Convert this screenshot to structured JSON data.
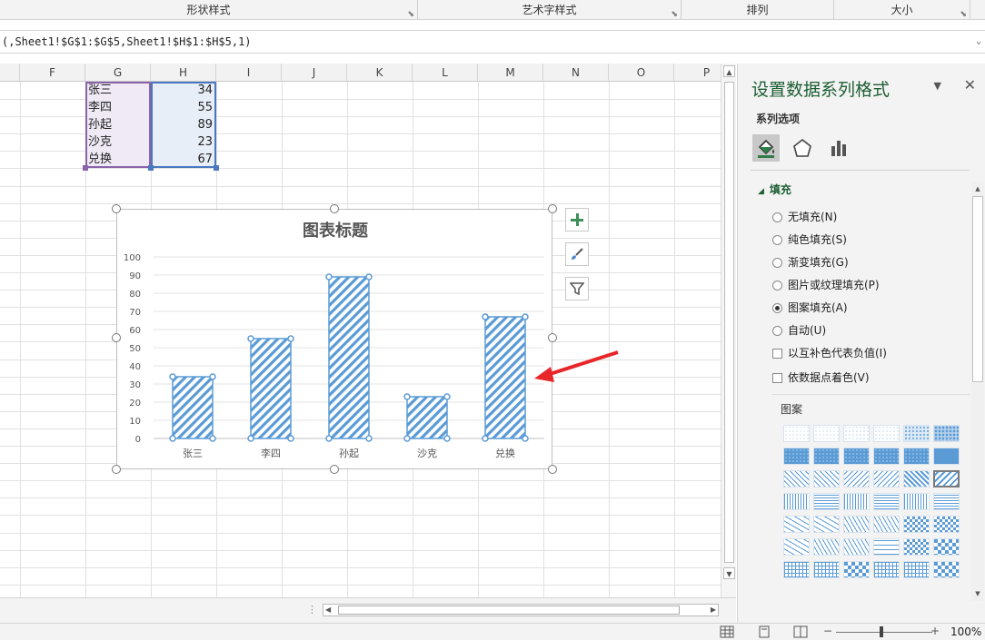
{
  "ribbon": {
    "groups": [
      {
        "label": "形状样式",
        "launcher": "⬊"
      },
      {
        "label": "艺术字样式",
        "launcher": "⬊"
      },
      {
        "label": "排列",
        "launcher": ""
      },
      {
        "label": "大小",
        "launcher": "⬊"
      }
    ]
  },
  "formula_bar": {
    "text": "(,Sheet1!$G$1:$G$5,Sheet1!$H$1:$H$5,1)"
  },
  "sheet": {
    "columns": [
      "F",
      "G",
      "H",
      "I",
      "J",
      "K",
      "L",
      "M",
      "N",
      "O",
      "P"
    ],
    "rows": [
      {
        "name": "张三",
        "value": "34"
      },
      {
        "name": "李四",
        "value": "55"
      },
      {
        "name": "孙起",
        "value": "89"
      },
      {
        "name": "沙克",
        "value": "23"
      },
      {
        "name": "兑换",
        "value": "67"
      }
    ]
  },
  "chart_data": {
    "type": "bar",
    "title": "图表标题",
    "categories": [
      "张三",
      "李四",
      "孙起",
      "沙克",
      "兑换"
    ],
    "values": [
      34,
      55,
      89,
      23,
      67
    ],
    "ylim": [
      0,
      100
    ],
    "yticks": [
      "0",
      "10",
      "20",
      "30",
      "40",
      "50",
      "60",
      "70",
      "80",
      "90",
      "100"
    ],
    "grid": true,
    "fill_pattern": "diagonal-stripes",
    "colors": {
      "bar": "#5b9bd5",
      "bar_bg": "#ffffff"
    }
  },
  "chart_tools": {
    "add_icon": "plus-icon",
    "style_icon": "brush-icon",
    "filter_icon": "filter-icon"
  },
  "pane": {
    "title": "设置数据系列格式",
    "subtitle": "系列选项",
    "section": "填充",
    "fill_options": [
      {
        "label": "无填充(N)",
        "selected": false
      },
      {
        "label": "纯色填充(S)",
        "selected": false
      },
      {
        "label": "渐变填充(G)",
        "selected": false
      },
      {
        "label": "图片或纹理填充(P)",
        "selected": false
      },
      {
        "label": "图案填充(A)",
        "selected": true
      },
      {
        "label": "自动(U)",
        "selected": false
      }
    ],
    "checkboxes": [
      {
        "label": "以互补色代表负值(I)"
      },
      {
        "label": "依数据点着色(V)"
      }
    ],
    "pattern_label": "图案",
    "accent": "#1d5e33"
  },
  "status": {
    "zoom": "100%"
  }
}
